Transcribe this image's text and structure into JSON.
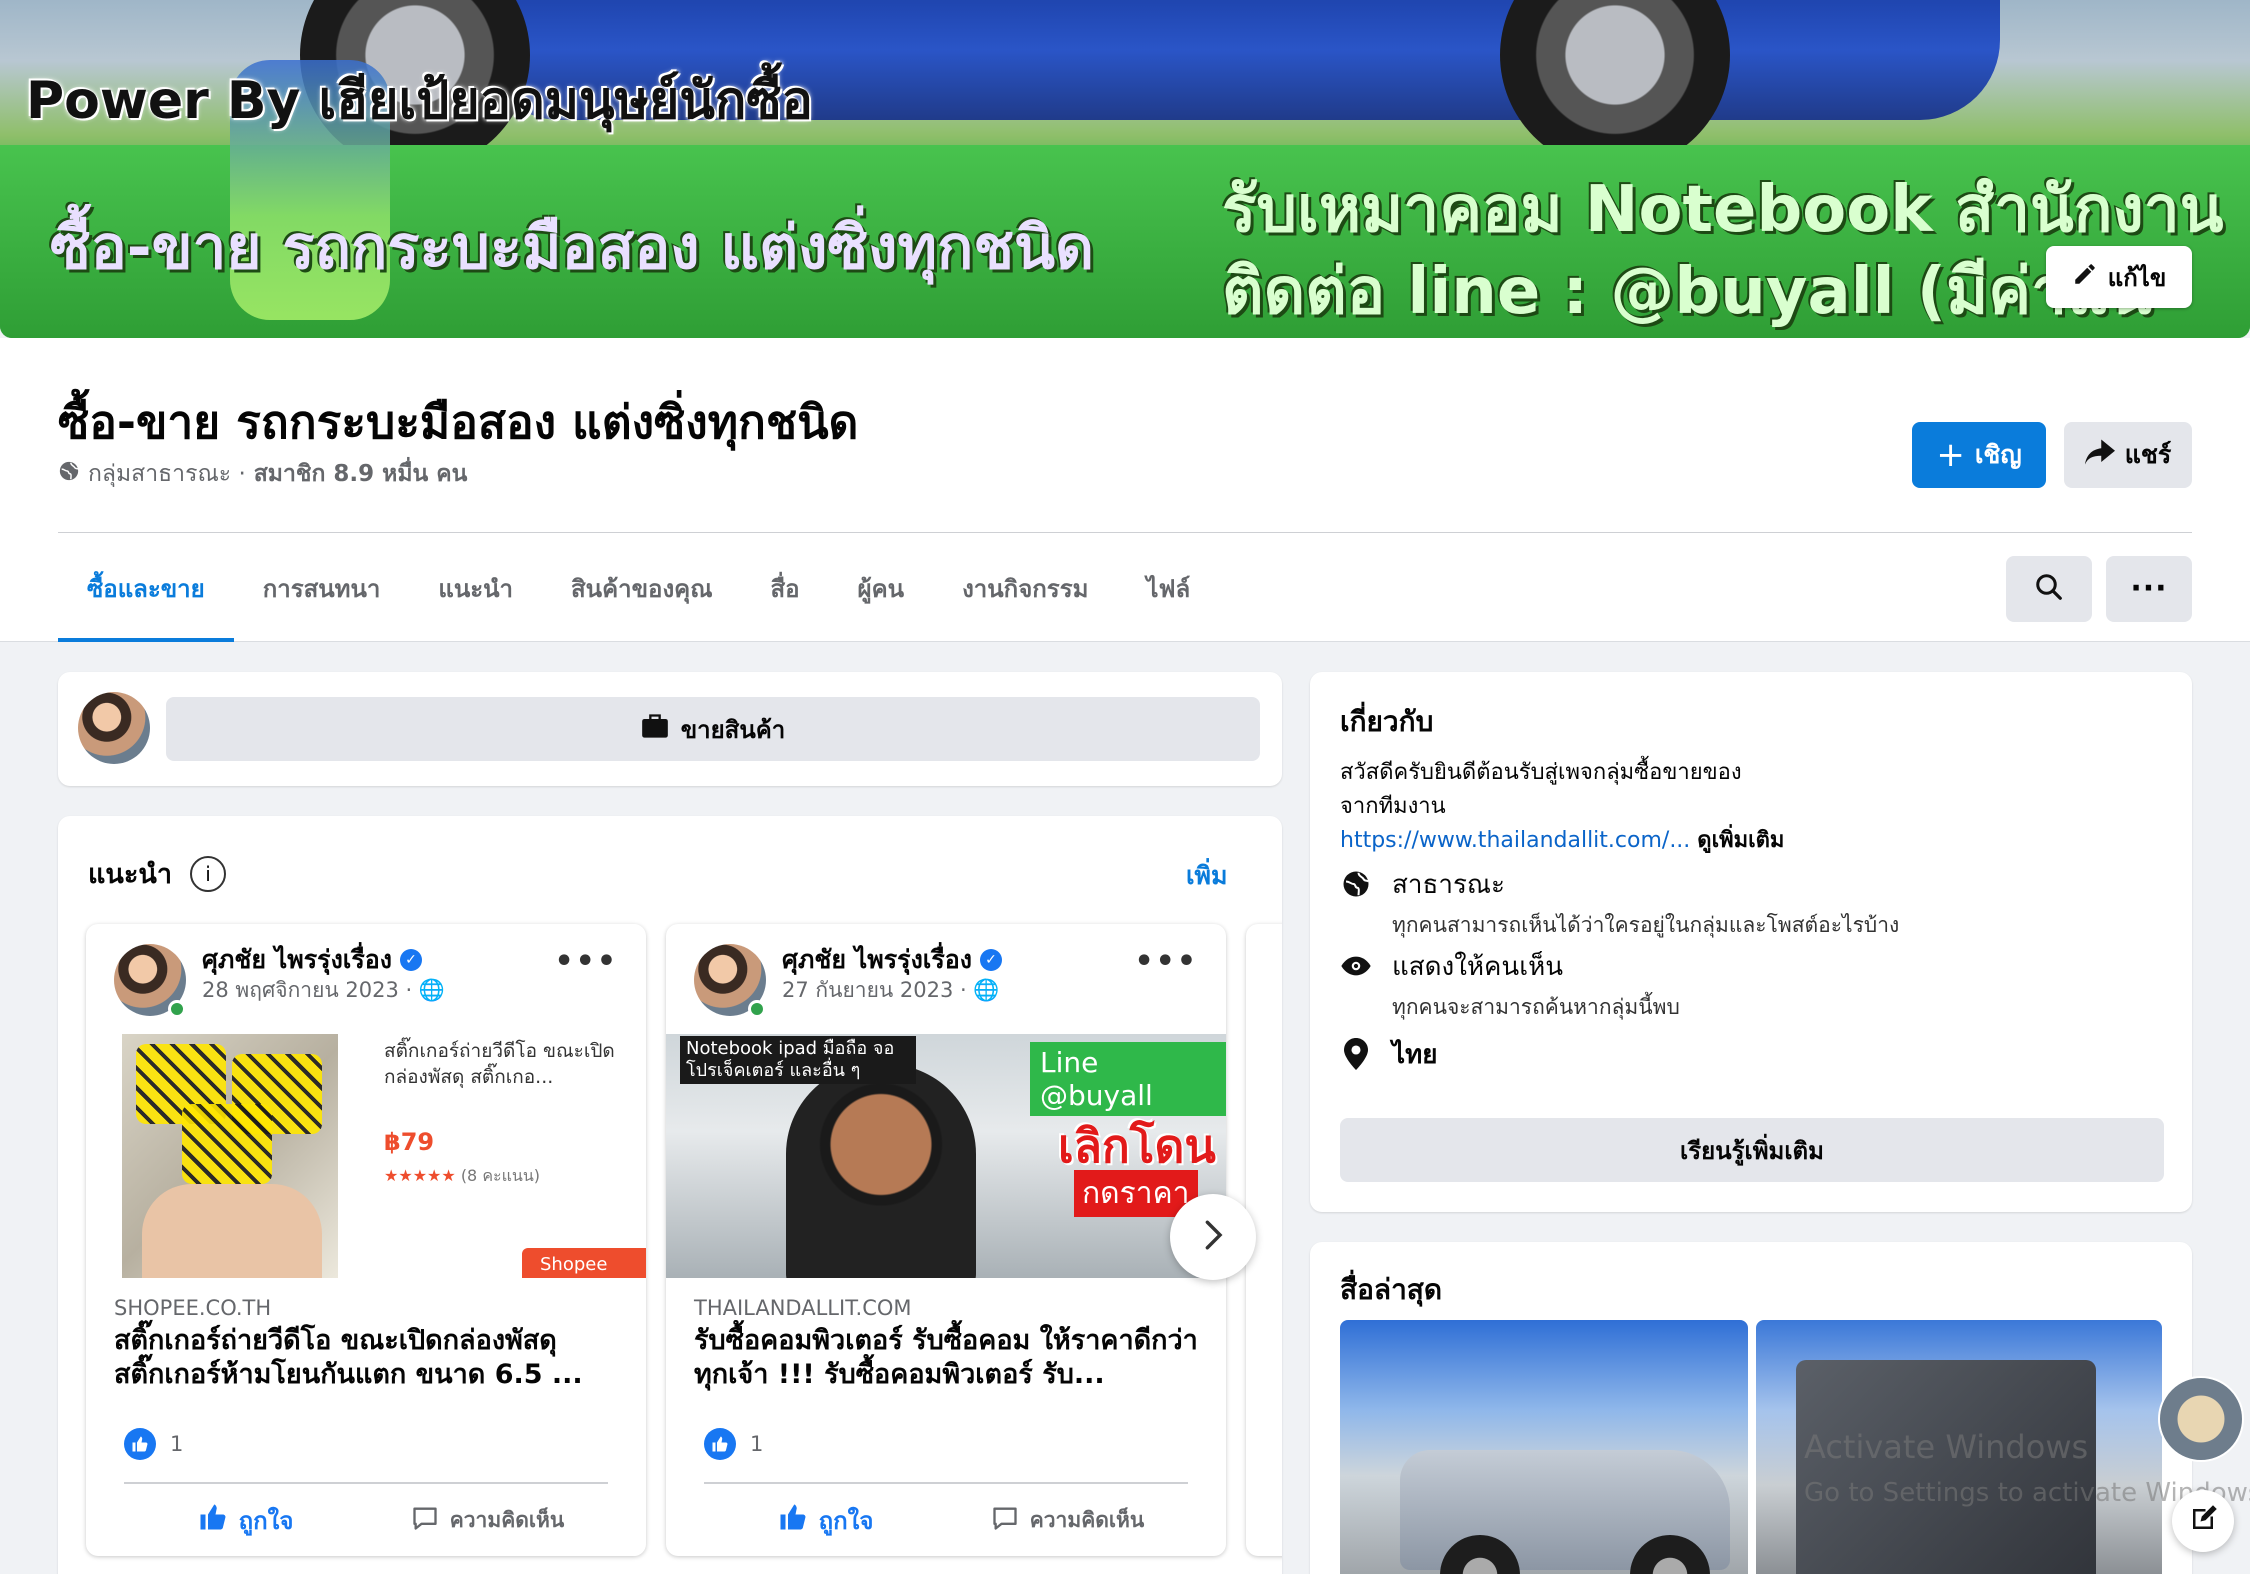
{
  "cover": {
    "power_text": "Power By เฮียเป้ยอดมนุษย์นักซื้อ",
    "left_text": "ซื้อ-ขาย รถกระบะมือสอง แต่งซิ่งทุกชนิด",
    "right_line1": "รับเหมาคอม Notebook สำนักงาน",
    "right_line2": "ติดต่อ line : @buyall (มีค่าแน",
    "edit_label": "แก้ไข"
  },
  "group": {
    "title": "ซื้อ-ขาย รถกระบะมือสอง แต่งซิ่งทุกชนิด",
    "privacy": "กลุ่มสาธารณะ ·",
    "members": "สมาชิก 8.9 หมื่น คน",
    "invite_label": "เชิญ",
    "share_label": "แชร์"
  },
  "tabs": [
    {
      "label": "ซื้อและขาย",
      "active": true
    },
    {
      "label": "การสนทนา"
    },
    {
      "label": "แนะนำ"
    },
    {
      "label": "สินค้าของคุณ"
    },
    {
      "label": "สื่อ"
    },
    {
      "label": "ผู้คน"
    },
    {
      "label": "งานกิจกรรม"
    },
    {
      "label": "ไฟล์"
    }
  ],
  "composer": {
    "sell_label": "ขายสินค้า"
  },
  "suggest": {
    "title": "แนะนำ",
    "more_label": "เพิ่ม",
    "posts": [
      {
        "author": "ศุภชัย ไพรรุ่งเรื่อง",
        "date": "28 พฤศจิกายน 2023 ·",
        "media_desc": "สติ๊กเกอร์ถ่ายวีดีโอ ขณะเปิดกล่องพัสดุ สติ๊กเกอ...",
        "media_price": "฿79",
        "media_stars": "★★★★★",
        "media_rating": "(8 คะแนน)",
        "media_logo": "Shopee",
        "source": "SHOPEE.CO.TH",
        "headline": "สติ๊กเกอร์ถ่ายวีดีโอ ขณะเปิดกล่องพัสดุ สติ๊กเกอร์ห้ามโยนกันแตก ขนาด 6.5 ...",
        "likes": "1",
        "like_label": "ถูกใจ",
        "comment_label": "ความคิดเห็น"
      },
      {
        "author": "ศุภชัย ไพรรุ่งเรื่อง",
        "date": "27 กันยายน 2023 ·",
        "media_tag": "Notebook ipad มือถือ จอ โปรเจ็คเตอร์ และอื่น ๆ",
        "media_line": "Line @buyall",
        "media_red1": "เลิกโดน",
        "media_red2": "กดราคา",
        "source": "THAILANDALLIT.COM",
        "headline": "รับซื้อคอมพิวเตอร์ รับซื้อคอม ให้ราคาดีกว่าทุกเจ้า !!! รับซื้อคอมพิวเตอร์ รับ...",
        "likes": "1",
        "like_label": "ถูกใจ",
        "comment_label": "ความคิดเห็น"
      }
    ]
  },
  "about": {
    "title": "เกี่ยวกับ",
    "desc_line1": "สวัสดีครับยินดีต้อนรับสู่เพจกลุ่มซื้อขายของ",
    "desc_line2": "จากทีมงาน",
    "link": "https://www.thailandallit.com/...",
    "see_more": "ดูเพิ่มเติม",
    "public_title": "สาธารณะ",
    "public_desc": "ทุกคนสามารถเห็นได้ว่าใครอยู่ในกลุ่มและโพสต์อะไรบ้าง",
    "visible_title": "แสดงให้คนเห็น",
    "visible_desc": "ทุกคนจะสามารถค้นหากลุ่มนี้พบ",
    "location": "ไทย",
    "learn_more": "เรียนรู้เพิ่มเติม"
  },
  "media": {
    "title": "สื่อล่าสุด"
  },
  "watermark": {
    "line1": "Activate Windows",
    "line2": "Go to Settings to activate Windows."
  },
  "colors": {
    "accent": "#0a7cdb",
    "like": "#1877f2",
    "shopee": "#ee4d2d"
  }
}
